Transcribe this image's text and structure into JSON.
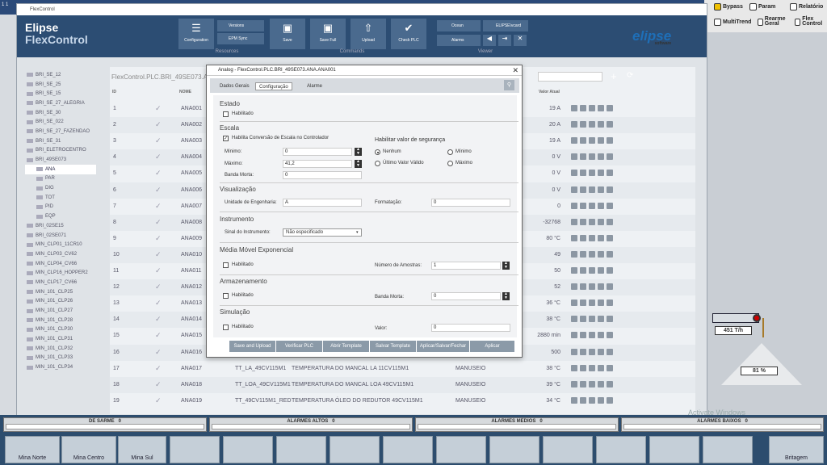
{
  "system": {
    "clock": "1 1"
  },
  "right_panel": {
    "bypass": "Bypass",
    "param": "Param",
    "relatorio": "Relatório",
    "multitrend": "MultiTrend",
    "rearme": "Rearme Geral",
    "flex": "Flex Control"
  },
  "window": {
    "title": "FlexControl",
    "logo_line1": "Elipse",
    "logo_line2": "FlexControl",
    "brand": "elipse",
    "brand_sub": "software"
  },
  "ribbon": {
    "resources": {
      "label": "Resources",
      "configuration": "Configuration",
      "versions": "Versions",
      "epm_sync": "EPM Sync"
    },
    "commands": {
      "label": "Commands",
      "save": "Save",
      "save_full": "Save Full",
      "upload": "Upload",
      "check_plc": "Check PLC"
    },
    "viewer": {
      "label": "Viewer",
      "ocean": "Ocean",
      "elipse_vcard": "ELIPSE\\vcard",
      "alarms": "Alarms"
    }
  },
  "tree": [
    "BRI_SE_12",
    "BRI_SE_25",
    "BRI_SE_15",
    "BRI_SE_27_ALEGRIA",
    "BRI_SE_30",
    "BRI_SE_022",
    "BRI_SE_27_FAZENDAO",
    "BRI_SE_31",
    "BRI_ELETROCENTRO",
    "BRI_49SE073",
    "ANA",
    "PAR",
    "DIG",
    "TOT",
    "PID",
    "EQP",
    "BRI_02SE15",
    "BRI_02SE071",
    "MIN_CLP01_11CR10",
    "MIN_CLP03_CV62",
    "MIN_CLP04_CV66",
    "MIN_CLP16_HOPPER2",
    "MIN_CLP17_CV66",
    "MIN_101_CLP25",
    "MIN_101_CLP26",
    "MIN_101_CLP27",
    "MIN_101_CLP28",
    "MIN_101_CLP30",
    "MIN_101_CLP31",
    "MIN_101_CLP32",
    "MIN_101_CLP33",
    "MIN_101_CLP34"
  ],
  "grid": {
    "breadcrumb": "FlexControl.PLC.BRI_49SE073.AN",
    "headers": {
      "id": "ID",
      "nome": "NOME",
      "valor": "Valor Atual"
    },
    "rows": [
      {
        "id": "1",
        "nome": "ANA001",
        "tag": "",
        "desc": "",
        "modo": "",
        "valor": "19 A"
      },
      {
        "id": "2",
        "nome": "ANA002",
        "tag": "",
        "desc": "",
        "modo": "",
        "valor": "20 A"
      },
      {
        "id": "3",
        "nome": "ANA003",
        "tag": "",
        "desc": "",
        "modo": "",
        "valor": "19 A"
      },
      {
        "id": "4",
        "nome": "ANA004",
        "tag": "",
        "desc": "",
        "modo": "",
        "valor": "0 V"
      },
      {
        "id": "5",
        "nome": "ANA005",
        "tag": "",
        "desc": "",
        "modo": "",
        "valor": "0 V"
      },
      {
        "id": "6",
        "nome": "ANA006",
        "tag": "",
        "desc": "",
        "modo": "",
        "valor": "0 V"
      },
      {
        "id": "7",
        "nome": "ANA007",
        "tag": "",
        "desc": "",
        "modo": "",
        "valor": "0"
      },
      {
        "id": "8",
        "nome": "ANA008",
        "tag": "",
        "desc": "",
        "modo": "",
        "valor": "-32768"
      },
      {
        "id": "9",
        "nome": "ANA009",
        "tag": "",
        "desc": "",
        "modo": "",
        "valor": "80 °C"
      },
      {
        "id": "10",
        "nome": "ANA010",
        "tag": "",
        "desc": "",
        "modo": "",
        "valor": "49"
      },
      {
        "id": "11",
        "nome": "ANA011",
        "tag": "",
        "desc": "",
        "modo": "",
        "valor": "50"
      },
      {
        "id": "12",
        "nome": "ANA012",
        "tag": "",
        "desc": "",
        "modo": "",
        "valor": "52"
      },
      {
        "id": "13",
        "nome": "ANA013",
        "tag": "",
        "desc": "",
        "modo": "",
        "valor": "36 °C"
      },
      {
        "id": "14",
        "nome": "ANA014",
        "tag": "",
        "desc": "",
        "modo": "",
        "valor": "38 °C"
      },
      {
        "id": "15",
        "nome": "ANA015",
        "tag": "",
        "desc": "",
        "modo": "",
        "valor": "2880 min"
      },
      {
        "id": "16",
        "nome": "ANA016",
        "tag": "",
        "desc": "",
        "modo": "",
        "valor": "500"
      },
      {
        "id": "17",
        "nome": "ANA017",
        "tag": "TT_LA_49CV115M1",
        "desc": "TEMPERATURA DO MANCAL LA 11CV115M1",
        "modo": "MANUSEIO",
        "valor": "38 °C"
      },
      {
        "id": "18",
        "nome": "ANA018",
        "tag": "TT_LOA_49CV115M1",
        "desc": "TEMPERATURA DO MANCAL LOA 49CV115M1",
        "modo": "MANUSEIO",
        "valor": "39 °C"
      },
      {
        "id": "19",
        "nome": "ANA019",
        "tag": "TT_49CV115M1_RED",
        "desc": "TEMPERATURA ÓLEO DO REDUTOR 49CV115M1",
        "modo": "MANUSEIO",
        "valor": "34 °C"
      }
    ]
  },
  "dialog": {
    "title": "Analog - FlexControl.PLC.BRI_49SE073.ANA.ANA001",
    "tabs": [
      "Dados Gerais",
      "Configuração",
      "Alarme"
    ],
    "estado": {
      "title": "Estado",
      "habilitado": "Habilitado"
    },
    "escala": {
      "title": "Escala",
      "habilita": "Habilita Conversão de Escala no Controlador",
      "minimo_label": "Mínimo:",
      "minimo": "0",
      "maximo_label": "Máximo:",
      "maximo": "41,2",
      "banda_label": "Banda Morta:",
      "banda": "0",
      "seguranca_title": "Habilitar valor de segurança",
      "nenhum": "Nenhum",
      "minimo_opt": "Mínimo",
      "ultimo": "Último Valor Válido",
      "maximo_opt": "Máximo"
    },
    "visualizacao": {
      "title": "Visualização",
      "unidade_label": "Unidade de Engenharia:",
      "unidade": "A",
      "formatacao_label": "Formatação:",
      "formatacao": "0"
    },
    "instrumento": {
      "title": "Instrumento",
      "sinal_label": "Sinal do Instrumento:",
      "sinal": "Não especificado"
    },
    "media": {
      "title": "Média Móvel Exponencial",
      "habilitado": "Habilitado",
      "amostras_label": "Número de Amostras:",
      "amostras": "1"
    },
    "armazenamento": {
      "title": "Armazenamento",
      "habilitado": "Habilitado",
      "banda_label": "Banda Morta:",
      "banda": "0"
    },
    "simulacao": {
      "title": "Simulação",
      "habilitado": "Habilitado",
      "valor_label": "Valor:",
      "valor": "0"
    },
    "buttons": [
      "Save and Upload",
      "Verificar PLC",
      "Abrir Template",
      "Salvar Template",
      "Aplicar/Salvar/Fechar",
      "Aplicar"
    ]
  },
  "plant": {
    "flow": "451 T/h",
    "level": "81 %"
  },
  "alarms": {
    "desarme": "DE SARME",
    "desarme_val": "0",
    "altos": "ALARMES ALTOS",
    "altos_val": "0",
    "medios": "ALARMES MEDIOS",
    "medios_val": "0",
    "baixos": "ALARMES BAIXOS",
    "baixos_val": "0"
  },
  "nav": {
    "mina_norte": "Mina Norte",
    "mina_centro": "Mina Centro",
    "mina_sul": "Mina Sul",
    "britagem": "Britagem"
  },
  "watermark": "Activate Windows"
}
